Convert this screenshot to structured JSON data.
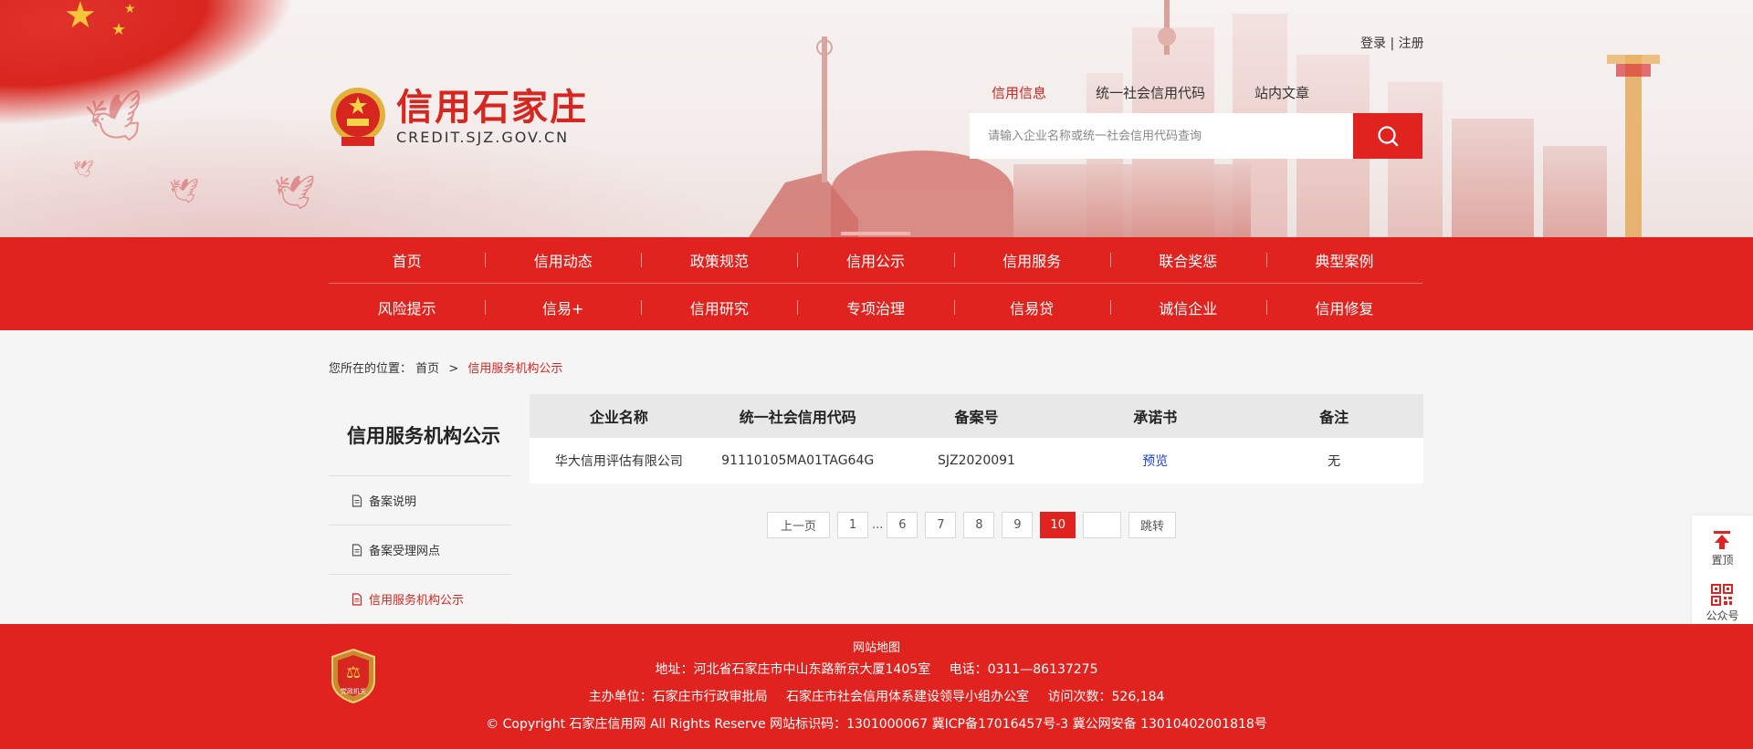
{
  "header": {
    "logo_title": "信用石家庄",
    "logo_domain": "CREDIT.SJZ.GOV.CN",
    "login_label": "登录",
    "login_separator": "|",
    "register_label": "注册",
    "search_tabs": [
      "信用信息",
      "统一社会信用代码",
      "站内文章"
    ],
    "active_search_tab": 0,
    "search_placeholder": "请输入企业名称或统一社会信用代码查询",
    "search_value": ""
  },
  "nav": {
    "row1": [
      "首页",
      "信用动态",
      "政策规范",
      "信用公示",
      "信用服务",
      "联合奖惩",
      "典型案例"
    ],
    "row2": [
      "风险提示",
      "信易+",
      "信用研究",
      "专项治理",
      "信易贷",
      "诚信企业",
      "信用修复"
    ],
    "current": "信用公示"
  },
  "breadcrumb": {
    "prefix": "您所在的位置：",
    "home": "首页",
    "separator": ">",
    "current": "信用服务机构公示"
  },
  "sidebar": {
    "title": "信用服务机构公示",
    "items": [
      "备案说明",
      "备案受理网点",
      "信用服务机构公示"
    ],
    "active_index": 2
  },
  "table": {
    "headers": [
      "企业名称",
      "统一社会信用代码",
      "备案号",
      "承诺书",
      "备注"
    ],
    "rows": [
      [
        "华大信用评估有限公司",
        "91110105MA01TAG64G",
        "SJZ2020091",
        "预览",
        "无"
      ]
    ]
  },
  "pagination": {
    "prev_label": "上一页",
    "pages_before": [
      "1"
    ],
    "ellipsis": "...",
    "pages_after": [
      "6",
      "7",
      "8",
      "9",
      "10"
    ],
    "current_page": "10",
    "jump_value": "",
    "jump_label": "跳转"
  },
  "float_panel": {
    "top_label": "置顶",
    "qr_label": "公众号"
  },
  "footer": {
    "sitemap": "网站地图",
    "address": "地址：河北省石家庄市中山东路新京大厦1405室",
    "phone": "电话：0311—86137275",
    "sponsor": "主办单位：石家庄市行政审批局",
    "organizer": "石家庄市社会信用体系建设领导小组办公室",
    "visits": "访问次数：526,184",
    "copyright": "© Copyright 石家庄信用网 All Rights Reserve 网站标识码：1301000067 冀ICP备17016457号-3 冀公网安备 13010402001818号",
    "badge_text": "党政机关"
  },
  "colors": {
    "brand_red": "#e0231f",
    "text_red": "#d7251f",
    "link_blue": "#1a3fcf"
  }
}
